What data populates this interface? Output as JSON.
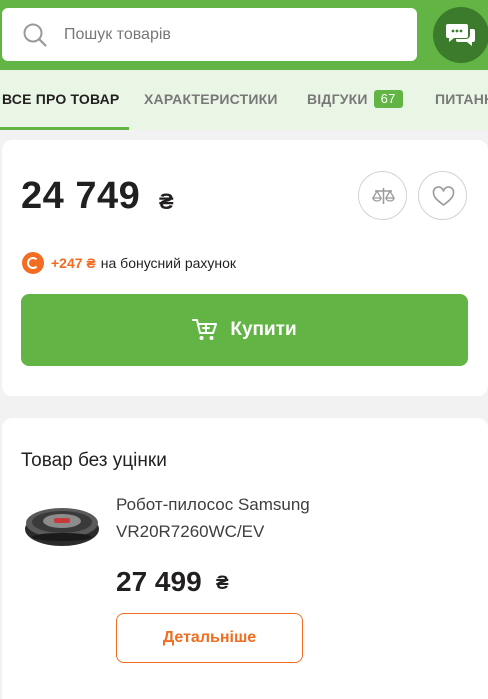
{
  "search": {
    "placeholder": "Пошук товарів",
    "icon": "search-icon"
  },
  "chat": {
    "icon": "chat-icon"
  },
  "tabs": [
    {
      "label": "ВСЕ ПРО ТОВАР",
      "active": true
    },
    {
      "label": "ХАРАКТЕРИСТИКИ",
      "active": false
    },
    {
      "label": "ВІДГУКИ",
      "badge": "67",
      "active": false
    },
    {
      "label": "ПИТАНН",
      "active": false
    }
  ],
  "offer": {
    "price": "24 749",
    "currency": "₴",
    "compare_icon": "scales-icon",
    "wishlist_icon": "heart-icon",
    "bonus": {
      "amount": "+247 ₴",
      "text": "на бонусний рахунок"
    },
    "buy_label": "Купити"
  },
  "alt_offer": {
    "title": "Товар без уцінки",
    "product_name": "Робот-пилосос Samsung VR20R7260WC/EV",
    "price": "27 499",
    "currency": "₴",
    "details_label": "Детальніше"
  },
  "colors": {
    "brand_green": "#62b544",
    "dark_green": "#3c7a2c",
    "tab_bg": "#eaf6e5",
    "accent_orange": "#f26d21"
  }
}
